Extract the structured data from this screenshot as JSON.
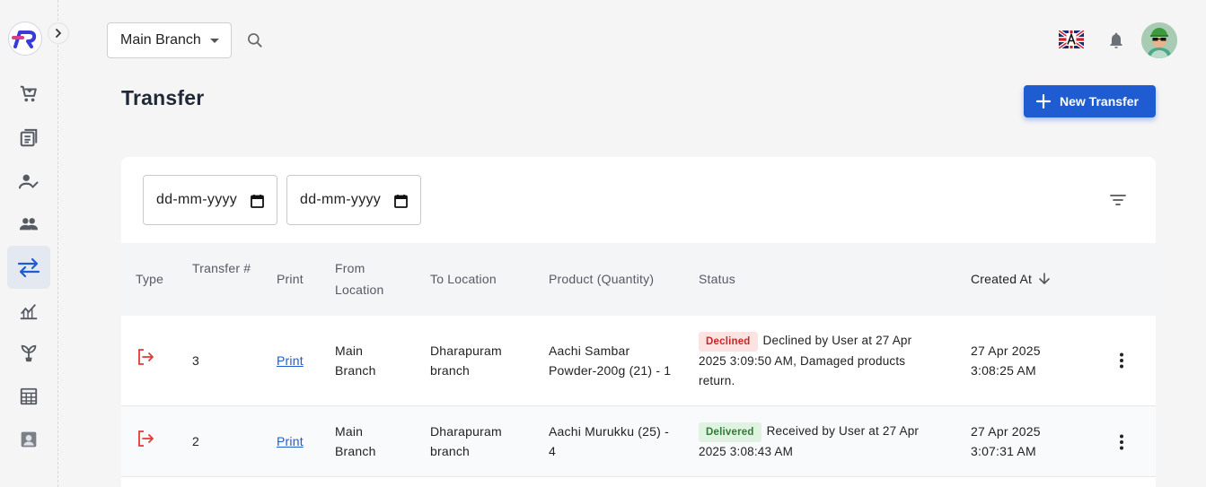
{
  "app": {
    "logo_letter": "R",
    "branch_select": {
      "value": "Main Branch"
    }
  },
  "sidebar": {
    "items": [
      {
        "name": "cart",
        "icon": "cart-icon"
      },
      {
        "name": "sales",
        "icon": "receipt-icon"
      },
      {
        "name": "customers",
        "icon": "person-check-icon"
      },
      {
        "name": "users",
        "icon": "group-icon"
      },
      {
        "name": "transfer",
        "icon": "swap-arrows-icon",
        "active": true
      },
      {
        "name": "reports",
        "icon": "chart-icon"
      },
      {
        "name": "plants",
        "icon": "plant-icon"
      },
      {
        "name": "calculator",
        "icon": "calculator-icon"
      },
      {
        "name": "contacts",
        "icon": "contact-icon"
      }
    ]
  },
  "page": {
    "title": "Transfer",
    "new_button_label": "New Transfer"
  },
  "filters": {
    "from_date": "dd-mm-yyyy",
    "to_date": "dd-mm-yyyy"
  },
  "table": {
    "columns": {
      "type": "Type",
      "transfer_no": "Transfer #",
      "print": "Print",
      "from_location": "From Location",
      "to_location": "To Location",
      "product": "Product (Quantity)",
      "status": "Status",
      "created_at": "Created At"
    },
    "rows": [
      {
        "transfer_no": "3",
        "print": "Print",
        "from_line1": "Main",
        "from_line2": "Branch",
        "to_line1": "Dharapuram",
        "to_line2": "branch",
        "product_line1": "Aachi Sambar",
        "product_line2": "Powder-200g (21) - 1",
        "status_badge": "Declined",
        "status_line1": "Declined by User at 27 Apr",
        "status_line2": "2025 3:09:50 AM, Damaged products",
        "status_line3": "return.",
        "created_line1": "27 Apr 2025",
        "created_line2": "3:08:25 AM"
      },
      {
        "transfer_no": "2",
        "print": "Print",
        "from_line1": "Main",
        "from_line2": "Branch",
        "to_line1": "Dharapuram",
        "to_line2": "branch",
        "product_line1": "Aachi Murukku (25) -",
        "product_line2": "4",
        "status_badge": "Delivered",
        "status_line1": "Received by User at 27 Apr",
        "status_line2": "2025 3:08:43 AM",
        "created_line1": "27 Apr 2025",
        "created_line2": "3:07:31 AM"
      }
    ]
  },
  "colors": {
    "primary": "#1f5bd1",
    "outgoing_icon": "#e53935",
    "declined_bg": "#fde2e2",
    "declined_text": "#c62828",
    "delivered_bg": "#dff3e0",
    "delivered_text": "#2e7d32"
  }
}
